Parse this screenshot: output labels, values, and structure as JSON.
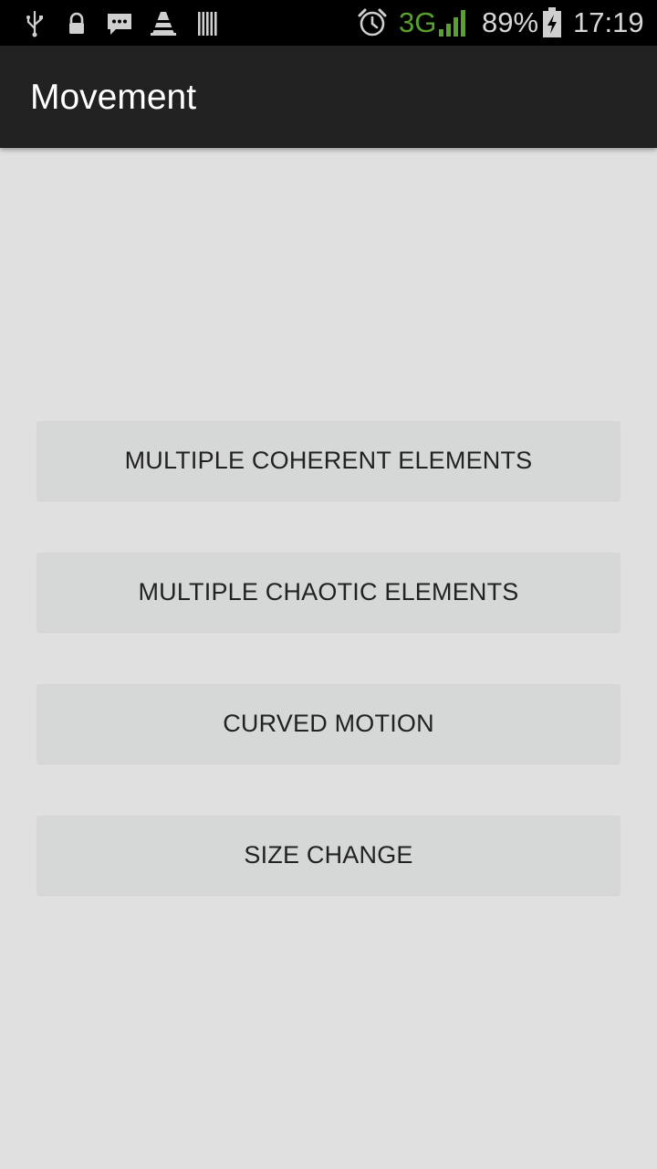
{
  "status_bar": {
    "left_icons": [
      "usb-icon",
      "lock-icon",
      "message-icon",
      "vlc-cone-icon",
      "barcode-icon"
    ],
    "alarm_icon": "alarm-clock-icon",
    "network_type": "3G",
    "signal_icon": "signal-bars-icon",
    "battery_percent": "89%",
    "battery_icon": "battery-charging-icon",
    "time": "17:19",
    "network_color": "#5aa02c"
  },
  "app_bar": {
    "title": "Movement",
    "background_color": "#212121"
  },
  "buttons": [
    {
      "label": "MULTIPLE COHERENT ELEMENTS"
    },
    {
      "label": "MULTIPLE CHAOTIC ELEMENTS"
    },
    {
      "label": "CURVED MOTION"
    },
    {
      "label": "SIZE CHANGE"
    }
  ]
}
